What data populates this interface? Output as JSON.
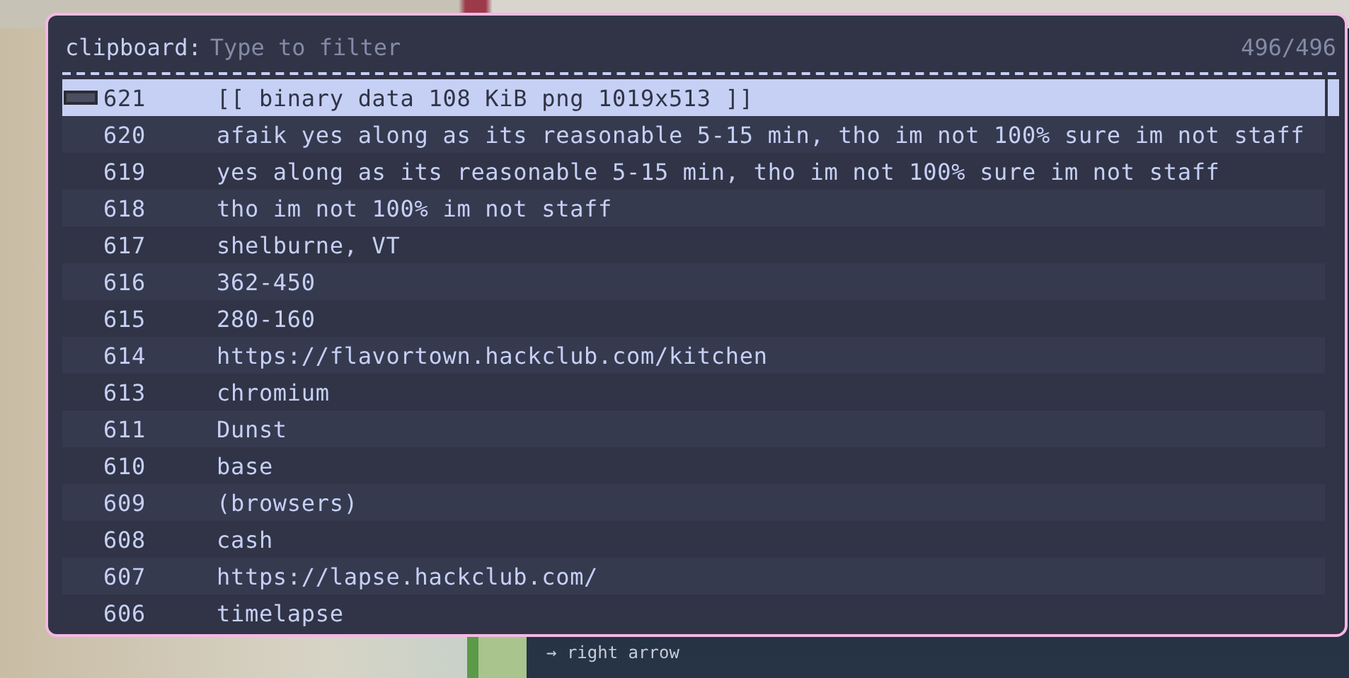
{
  "prompt": {
    "label": "clipboard:",
    "placeholder": "Type to filter",
    "count": "496/496"
  },
  "entries": [
    {
      "id": "621",
      "text": "[[ binary data 108 KiB png 1019x513 ]]",
      "kind": "image",
      "selected": true
    },
    {
      "id": "620",
      "text": "afaik yes along as its reasonable 5-15 min, tho im not 100% sure im not staff",
      "kind": "text",
      "selected": false
    },
    {
      "id": "619",
      "text": "yes along as its reasonable 5-15 min, tho im not 100% sure im not staff",
      "kind": "text",
      "selected": false
    },
    {
      "id": "618",
      "text": "tho im not 100% im not staff",
      "kind": "text",
      "selected": false
    },
    {
      "id": "617",
      "text": "shelburne, VT",
      "kind": "text",
      "selected": false
    },
    {
      "id": "616",
      "text": "362-450",
      "kind": "text",
      "selected": false
    },
    {
      "id": "615",
      "text": "280-160",
      "kind": "text",
      "selected": false
    },
    {
      "id": "614",
      "text": "https://flavortown.hackclub.com/kitchen",
      "kind": "text",
      "selected": false
    },
    {
      "id": "613",
      "text": "chromium",
      "kind": "text",
      "selected": false
    },
    {
      "id": "611",
      "text": "Dunst",
      "kind": "text",
      "selected": false
    },
    {
      "id": "610",
      "text": "base",
      "kind": "text",
      "selected": false
    },
    {
      "id": "609",
      "text": "(browsers)",
      "kind": "text",
      "selected": false
    },
    {
      "id": "608",
      "text": "cash",
      "kind": "text",
      "selected": false
    },
    {
      "id": "607",
      "text": "https://lapse.hackclub.com/",
      "kind": "text",
      "selected": false
    },
    {
      "id": "606",
      "text": "timelapse",
      "kind": "text",
      "selected": false
    }
  ],
  "background": {
    "visible_text": "→ right arrow"
  }
}
